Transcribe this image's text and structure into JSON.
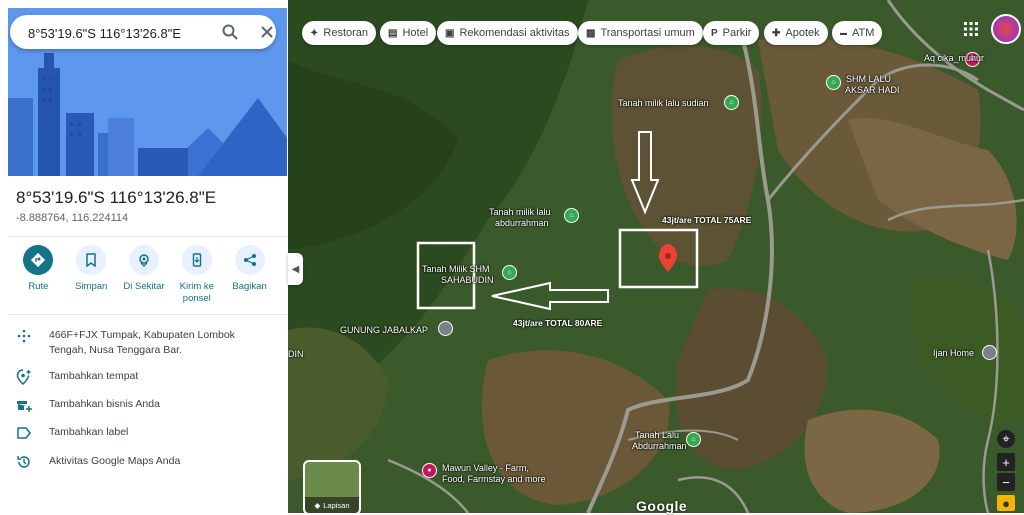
{
  "search": {
    "value": "8°53'19.6\"S 116°13'26.8\"E"
  },
  "place": {
    "title": "8°53'19.6\"S 116°13'26.8\"E",
    "decimal": "-8.888764, 116.224114"
  },
  "actions": [
    {
      "label": "Rute",
      "icon": "directions-icon"
    },
    {
      "label": "Simpan",
      "icon": "bookmark-icon"
    },
    {
      "label": "Di Sekitar",
      "icon": "nearby-icon"
    },
    {
      "label": "Kirim ke ponsel",
      "icon": "send-to-phone-icon"
    },
    {
      "label": "Bagikan",
      "icon": "share-icon"
    }
  ],
  "info": [
    {
      "icon": "plus-code-icon",
      "text": "466F+FJX Tumpak, Kabupaten Lombok Tengah, Nusa Tenggara Bar."
    },
    {
      "icon": "add-place-icon",
      "text": "Tambahkan tempat"
    },
    {
      "icon": "add-business-icon",
      "text": "Tambahkan bisnis Anda"
    },
    {
      "icon": "label-icon",
      "text": "Tambahkan label"
    },
    {
      "icon": "history-icon",
      "text": "Aktivitas Google Maps Anda"
    }
  ],
  "chips": [
    {
      "label": "Restoran",
      "icon": "restaurant-icon"
    },
    {
      "label": "Hotel",
      "icon": "hotel-icon"
    },
    {
      "label": "Rekomendasi aktivitas",
      "icon": "camera-icon"
    },
    {
      "label": "Transportasi umum",
      "icon": "bus-icon"
    },
    {
      "label": "Parkir",
      "icon": "parking-icon"
    },
    {
      "label": "Apotek",
      "icon": "pharmacy-icon"
    },
    {
      "label": "ATM",
      "icon": "atm-icon"
    }
  ],
  "map_labels": {
    "tanah_sudian": "Tanah milik lalu sudian",
    "tanah_abdurrahman_1": "Tanah milik lalu",
    "tanah_abdurrahman_2": "abdurrahman",
    "shm_sahabudin_1": "Tanah Milik SHM",
    "shm_sahabudin_2": "SAHABUDIN",
    "gunung": "GUNUNG JABALKAP",
    "din": "DIN",
    "shm_aksar_1": "SHM LALU",
    "shm_aksar_2": "AKSAR HADI",
    "aq_cika": "Aq cika_muhur",
    "ijan_home": "Ijan Home",
    "tanah_lalu_1": "Tanah Lalu",
    "tanah_lalu_2": "Abdurrahman",
    "mawun_1": "Mawun Valley - Farm,",
    "mawun_2": "Food, Farmstay and more",
    "price_75": "43jt/are TOTAL 75ARE",
    "price_80": "43jt/are TOTAL 80ARE"
  },
  "layers_label": "Lapisan",
  "logo": "Google",
  "colors": {
    "accent": "#137387",
    "pin": "#ea4335",
    "poi": "#34a853"
  }
}
